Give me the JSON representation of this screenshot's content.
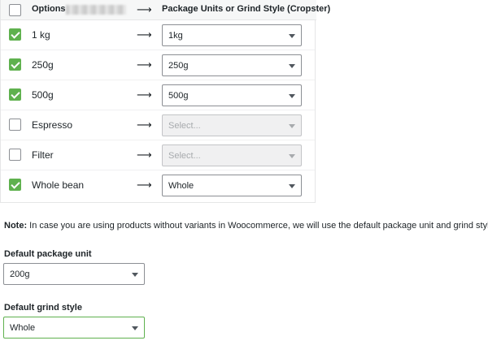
{
  "header": {
    "options_label": "Options",
    "arrow": "⟶",
    "target_label": "Package Units or Grind Style (Cropster)"
  },
  "rows": [
    {
      "label": "1 kg",
      "checked": true,
      "value": "1kg",
      "disabled": false
    },
    {
      "label": "250g",
      "checked": true,
      "value": "250g",
      "disabled": false
    },
    {
      "label": "500g",
      "checked": true,
      "value": "500g",
      "disabled": false
    },
    {
      "label": "Espresso",
      "checked": false,
      "value": "Select...",
      "disabled": true
    },
    {
      "label": "Filter",
      "checked": false,
      "value": "Select...",
      "disabled": true
    },
    {
      "label": "Whole bean",
      "checked": true,
      "value": "Whole",
      "disabled": false
    }
  ],
  "note": {
    "prefix": "Note:",
    "text": " In case you are using products without variants in Woocommerce, we will use the default package unit and grind style."
  },
  "default_package_unit": {
    "label": "Default package unit",
    "value": "200g"
  },
  "default_grind_style": {
    "label": "Default grind style",
    "value": "Whole"
  },
  "colors": {
    "accent": "#5fb14e",
    "border": "#8c8f94"
  }
}
